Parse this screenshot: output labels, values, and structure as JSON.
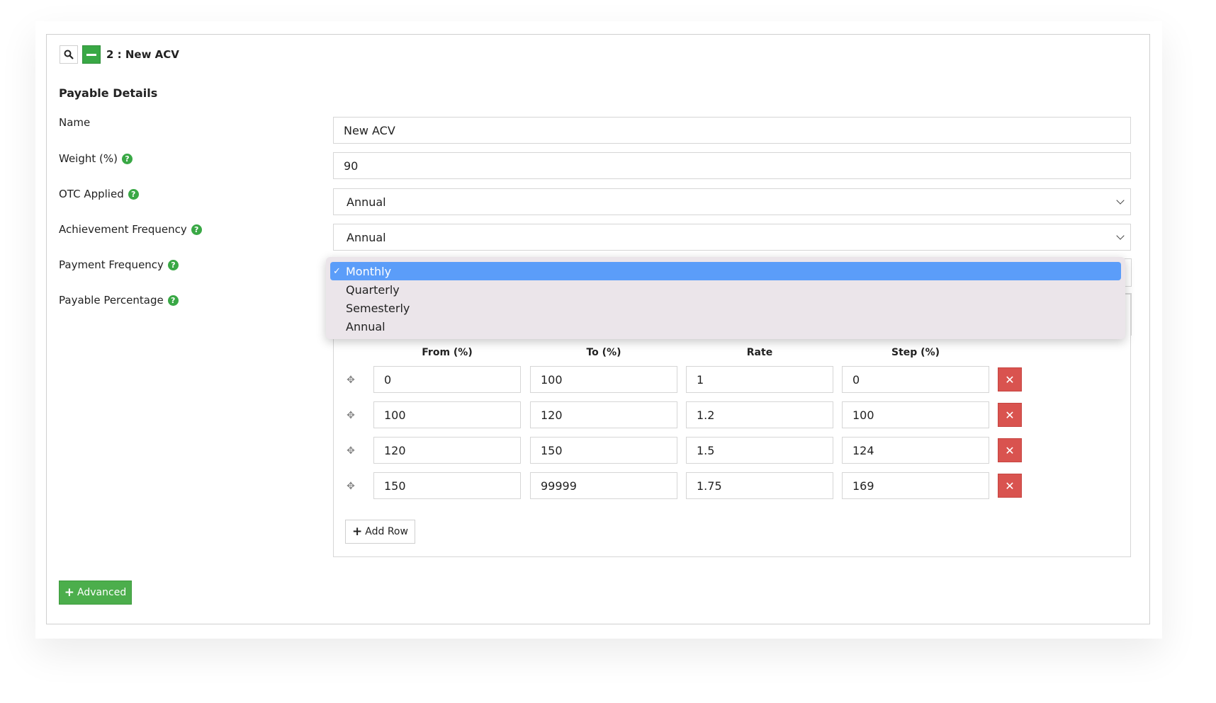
{
  "header": {
    "title": "2 : New ACV"
  },
  "section": {
    "title": "Payable Details"
  },
  "fields": {
    "name": {
      "label": "Name",
      "value": "New ACV"
    },
    "weight": {
      "label": "Weight (%)",
      "value": "90"
    },
    "otc": {
      "label": "OTC Applied",
      "value": "Annual"
    },
    "achievement": {
      "label": "Achievement Frequency",
      "value": "Annual"
    },
    "payment": {
      "label": "Payment Frequency"
    },
    "payable": {
      "label": "Payable Percentage"
    }
  },
  "dropdown": {
    "selected": "Monthly",
    "options": [
      "Monthly",
      "Quarterly",
      "Semesterly",
      "Annual"
    ]
  },
  "table": {
    "headers": [
      "From (%)",
      "To (%)",
      "Rate",
      "Step (%)"
    ],
    "rows": [
      [
        "0",
        "100",
        "1",
        "0"
      ],
      [
        "100",
        "120",
        "1.2",
        "100"
      ],
      [
        "120",
        "150",
        "1.5",
        "124"
      ],
      [
        "150",
        "99999",
        "1.75",
        "169"
      ]
    ],
    "add_row_label": "Add Row"
  },
  "advanced_label": "Advanced",
  "colors": {
    "accent_green": "#39a845",
    "delete_red": "#d9534f",
    "selected_blue": "#5b9df9"
  }
}
